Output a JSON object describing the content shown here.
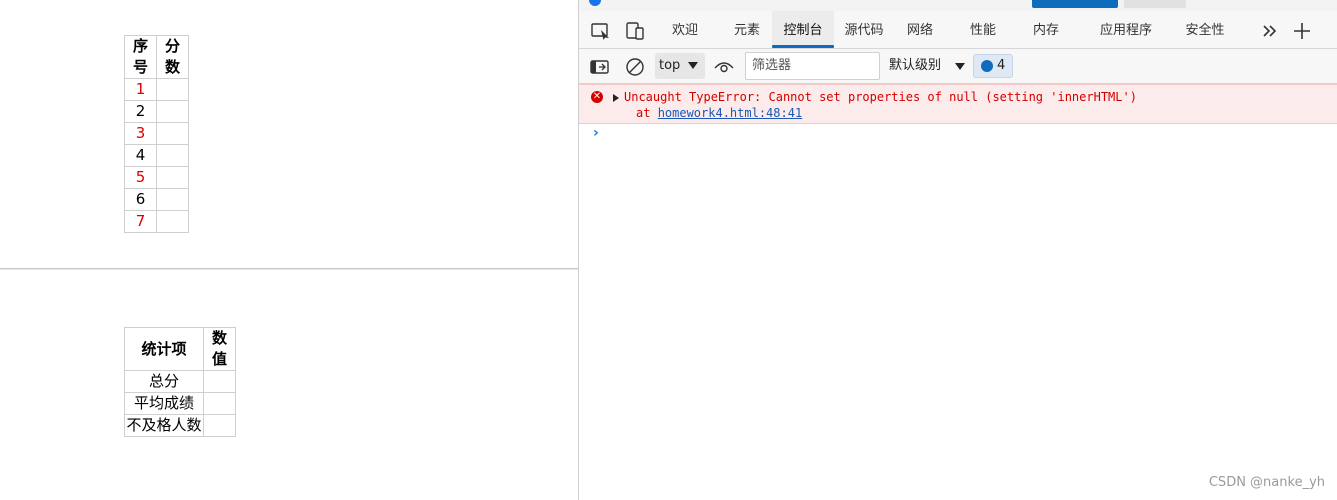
{
  "left_page": {
    "score_table": {
      "headers": [
        "序号",
        "分数"
      ],
      "rows": [
        {
          "num": "1",
          "score": ""
        },
        {
          "num": "2",
          "score": ""
        },
        {
          "num": "3",
          "score": ""
        },
        {
          "num": "4",
          "score": ""
        },
        {
          "num": "5",
          "score": ""
        },
        {
          "num": "6",
          "score": ""
        },
        {
          "num": "7",
          "score": ""
        }
      ]
    },
    "stat_table": {
      "headers": [
        "统计项",
        "数值"
      ],
      "rows": [
        {
          "item": "总分",
          "value": ""
        },
        {
          "item": "平均成绩",
          "value": ""
        },
        {
          "item": "不及格人数",
          "value": ""
        }
      ]
    }
  },
  "devtools": {
    "tabs": [
      "欢迎",
      "元素",
      "控制台",
      "源代码",
      "网络",
      "性能",
      "内存",
      "应用程序",
      "安全性"
    ],
    "active_tab": "控制台",
    "toolbar": {
      "context": "top",
      "filter_placeholder": "筛选器",
      "level": "默认级别",
      "issues_count": "4"
    },
    "console": {
      "error_message": "Uncaught TypeError: Cannot set properties of null (setting 'innerHTML')",
      "error_at": "at",
      "error_location": "homework4.html:48:41"
    }
  },
  "watermark": "CSDN @nanke_yh",
  "colors": {
    "accent": "#0f6cbd",
    "error": "#d40000",
    "red_text": "#e00000"
  }
}
